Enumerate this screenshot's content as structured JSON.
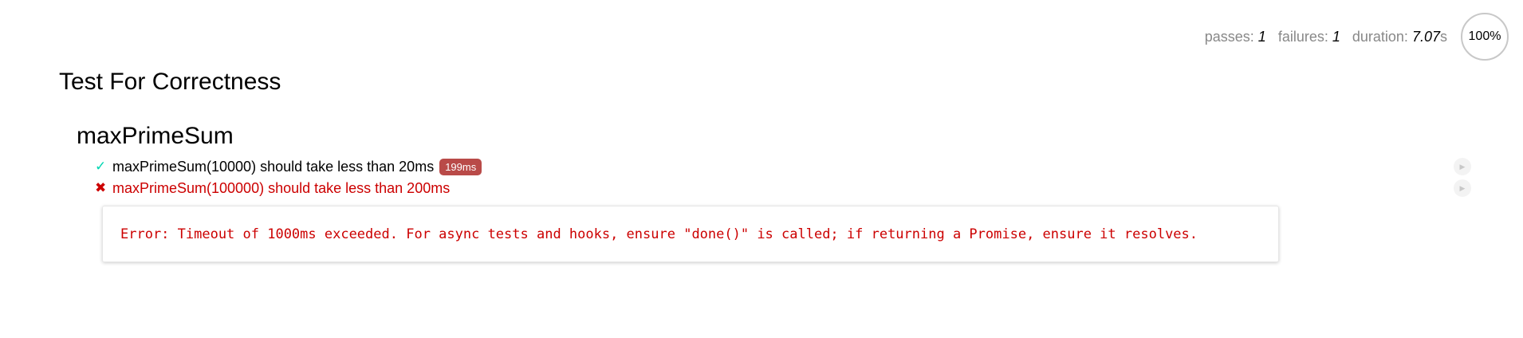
{
  "stats": {
    "passes_label": "passes:",
    "passes_value": "1",
    "failures_label": "failures:",
    "failures_value": "1",
    "duration_label": "duration:",
    "duration_value": "7.07",
    "duration_unit": "s",
    "progress": "100%"
  },
  "suite": {
    "title": "Test For Correctness",
    "sub_suite": {
      "title": "maxPrimeSum",
      "tests": [
        {
          "status": "pass",
          "mark": "✓",
          "title": "maxPrimeSum(10000) should take less than 20ms",
          "duration": "199ms"
        },
        {
          "status": "fail",
          "mark": "✖",
          "title": "maxPrimeSum(100000) should take less than 200ms",
          "error": "Error: Timeout of 1000ms exceeded. For async tests and hooks, ensure \"done()\" is called; if returning a Promise, ensure it resolves."
        }
      ]
    }
  },
  "icons": {
    "replay": "▶"
  },
  "colors": {
    "pass": "#00d6b2",
    "fail": "#cc0000",
    "slow_badge": "#b94a48"
  }
}
